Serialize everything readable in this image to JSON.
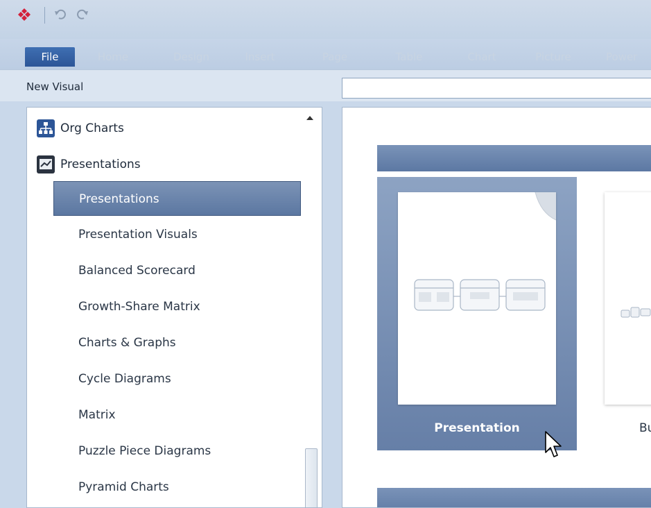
{
  "quick_access": {
    "app_icon": "app-diamond-icon",
    "undo_icon": "undo-icon",
    "redo_icon": "redo-icon"
  },
  "ribbon": {
    "tabs": [
      "File",
      "Home",
      "Design",
      "Insert",
      "Page",
      "Table",
      "Chart",
      "Picture",
      "Power"
    ]
  },
  "header": {
    "title": "New Visual",
    "search_value": ""
  },
  "categories": [
    {
      "label": "Org Charts",
      "icon": "org-chart-icon"
    },
    {
      "label": "Presentations",
      "icon": "presentation-icon"
    }
  ],
  "subitems": [
    "Presentations",
    "Presentation Visuals",
    "Balanced Scorecard",
    "Growth-Share Matrix",
    "Charts & Graphs",
    "Cycle Diagrams",
    "Matrix",
    "Puzzle Piece Diagrams",
    "Pyramid Charts"
  ],
  "selected_subitem": "Presentations",
  "gallery": {
    "tiles": [
      {
        "caption": "Presentation",
        "selected": true
      },
      {
        "caption": "Bu",
        "selected": false
      }
    ]
  },
  "colors": {
    "accent": "#2c5597",
    "selection": "#5b77a1",
    "brand": "#d3203a"
  }
}
